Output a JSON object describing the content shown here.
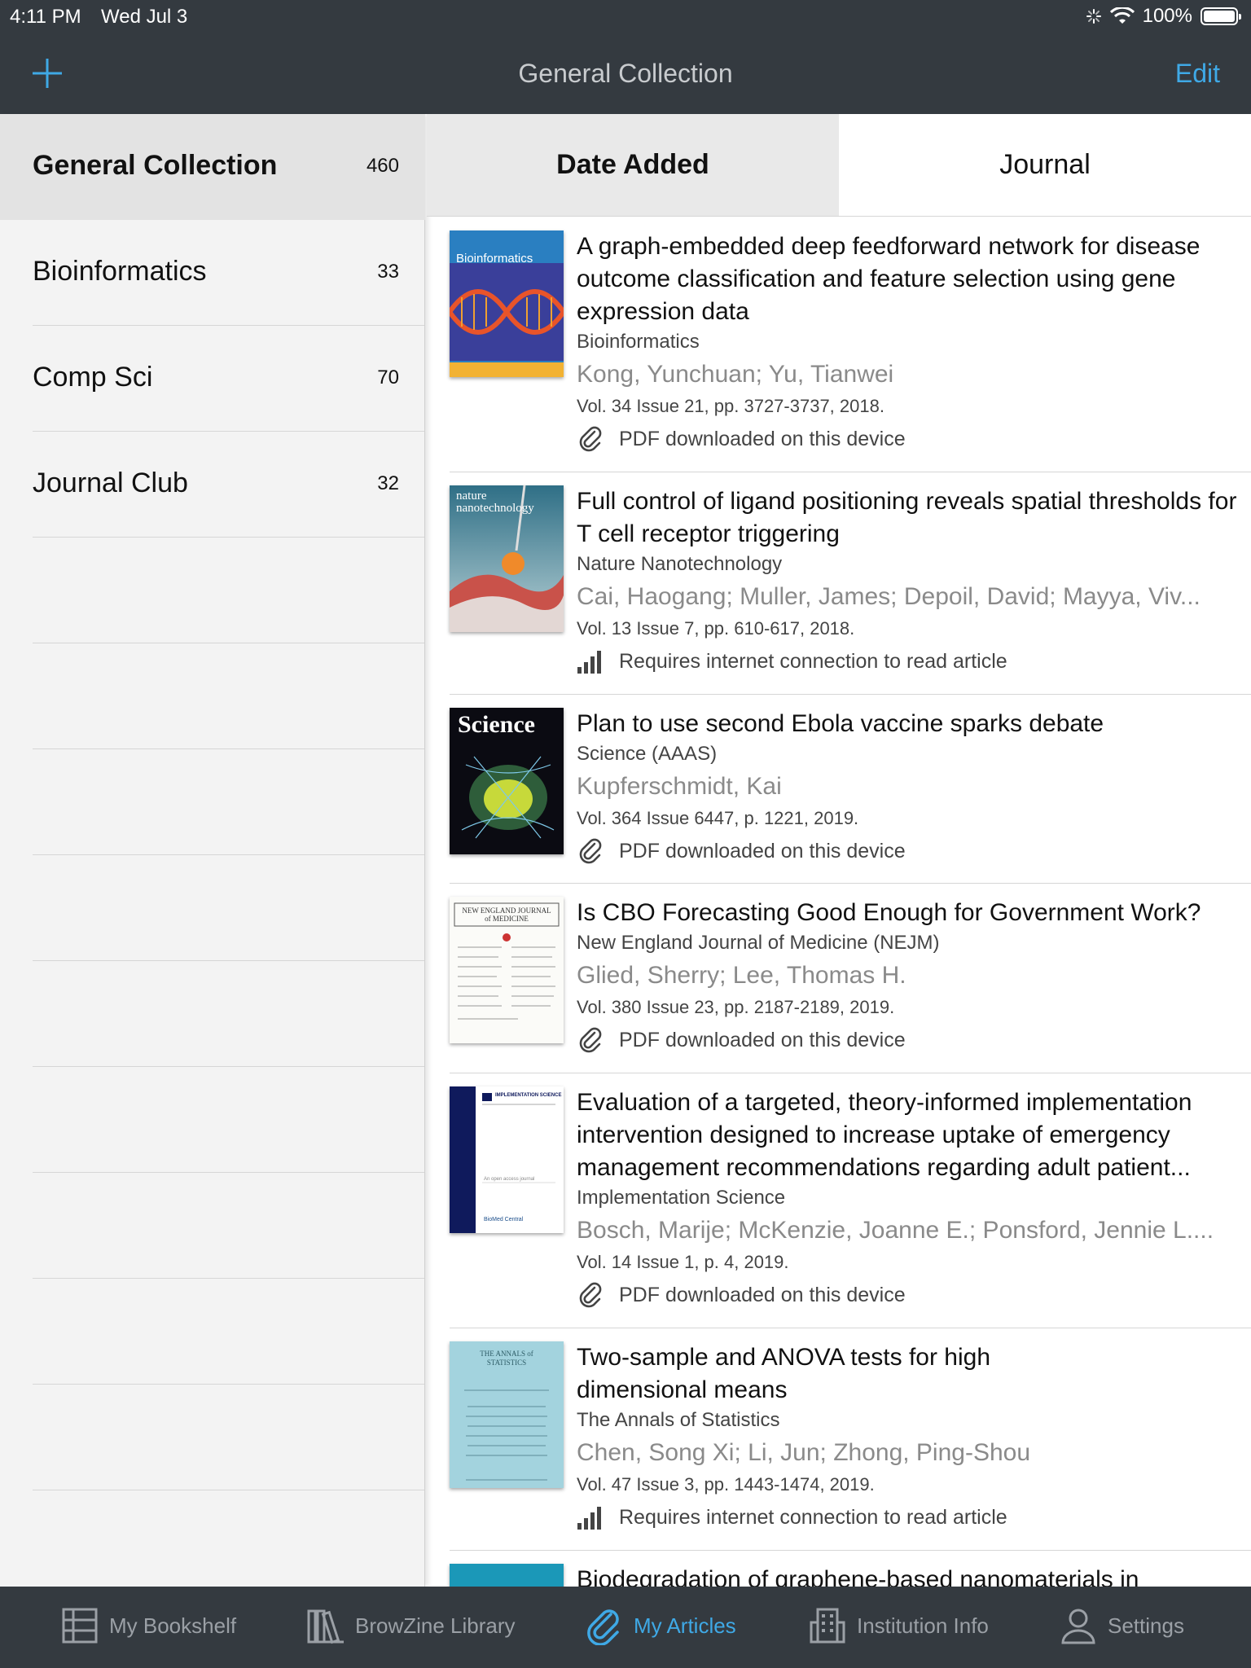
{
  "status": {
    "time": "4:11 PM",
    "date": "Wed Jul 3",
    "battery": "100%"
  },
  "nav": {
    "title": "General Collection",
    "edit_label": "Edit"
  },
  "sidebar": {
    "items": [
      {
        "label": "General Collection",
        "count": "460"
      },
      {
        "label": "Bioinformatics",
        "count": "33"
      },
      {
        "label": "Comp Sci",
        "count": "70"
      },
      {
        "label": "Journal Club",
        "count": "32"
      }
    ]
  },
  "sort_tabs": [
    {
      "label": "Date Added"
    },
    {
      "label": "Journal"
    }
  ],
  "articles": [
    {
      "title": "A graph-embedded deep feedforward network for disease outcome classification and feature selection using gene expression data",
      "journal": "Bioinformatics",
      "authors": "Kong, Yunchuan; Yu, Tianwei",
      "volume": "Vol. 34 Issue 21, pp. 3727-3737, 2018.",
      "status": "PDF downloaded on this device",
      "cover_text": "Bioinformatics"
    },
    {
      "title": "Full control of ligand positioning reveals spatial thresholds for T cell receptor triggering",
      "journal": "Nature Nanotechnology",
      "authors": "Cai, Haogang; Muller, James; Depoil, David; Mayya, Viv...",
      "volume": "Vol. 13 Issue 7, pp. 610-617, 2018.",
      "status": "Requires internet connection to read article",
      "cover_text": "nature nanotechnology"
    },
    {
      "title": "Plan to use second Ebola vaccine sparks debate",
      "journal": "Science (AAAS)",
      "authors": "Kupferschmidt, Kai",
      "volume": "Vol. 364 Issue 6447, p. 1221, 2019.",
      "status": "PDF downloaded on this device",
      "cover_text": "Science"
    },
    {
      "title": "Is CBO Forecasting Good Enough for Government Work?",
      "journal": "New England Journal of Medicine (NEJM)",
      "authors": "Glied, Sherry; Lee, Thomas H.",
      "volume": "Vol. 380 Issue 23, pp. 2187-2189, 2019.",
      "status": "PDF downloaded on this device",
      "cover_text": "NEW ENGLAND JOURNAL of MEDICINE"
    },
    {
      "title": "Evaluation of a targeted, theory-informed implementation intervention designed to increase uptake of emergency management recommendations regarding adult patient...",
      "journal": "Implementation Science",
      "authors": "Bosch, Marije; McKenzie, Joanne E.; Ponsford, Jennie L....",
      "volume": "Vol. 14 Issue 1, p. 4, 2019.",
      "status": "PDF downloaded on this device",
      "cover_text": "IMPLEMENTATION SCIENCE"
    },
    {
      "title": "Two-sample and ANOVA tests for high dimensional means",
      "journal": "The Annals of Statistics",
      "authors": "Chen, Song Xi; Li, Jun; Zhong, Ping-Shou",
      "volume": "Vol. 47 Issue 3, pp. 1443-1474, 2019.",
      "status": "Requires internet connection to read article",
      "cover_text": "THE ANNALS of STATISTICS"
    },
    {
      "title": "Biodegradation of graphene-based nanomaterials in"
    }
  ],
  "tabbar": [
    {
      "label": "My Bookshelf",
      "icon": "bookshelf-icon"
    },
    {
      "label": "BrowZine Library",
      "icon": "library-icon"
    },
    {
      "label": "My Articles",
      "icon": "paperclip-icon"
    },
    {
      "label": "Institution Info",
      "icon": "building-icon"
    },
    {
      "label": "Settings",
      "icon": "person-icon"
    }
  ],
  "colors": {
    "accent": "#3fa9e6",
    "bar": "#343a40"
  }
}
